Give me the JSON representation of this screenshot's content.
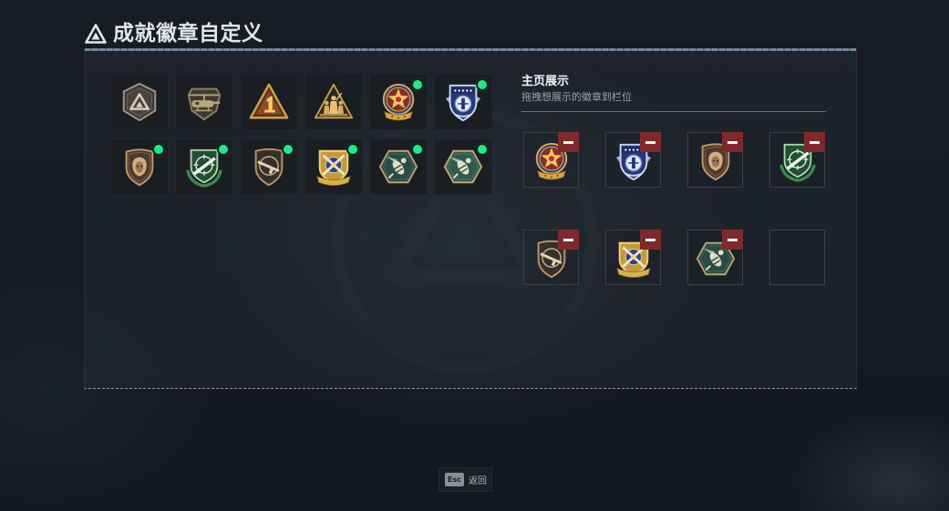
{
  "screen": {
    "title": "成就徽章自定义",
    "title_icon": "triangle-logo-icon"
  },
  "theme": {
    "background": "#151a20",
    "indicator": "#2fe08c",
    "remove": "#7e2a2d",
    "text_primary": "#ececec",
    "text_secondary": "#9ea3a8"
  },
  "badge_collection": {
    "badges": [
      {
        "icon": "triangle-hex-badge-icon",
        "indicator": false
      },
      {
        "icon": "helicopter-badge-icon",
        "indicator": false
      },
      {
        "icon": "triangle-one-badge-icon",
        "indicator": false
      },
      {
        "icon": "soldiers-triangle-badge-icon",
        "indicator": false
      },
      {
        "icon": "star-medal-badge-icon",
        "indicator": true
      },
      {
        "icon": "blue-shield-badge-icon",
        "indicator": true
      },
      {
        "icon": "lion-shield-badge-icon",
        "indicator": true
      },
      {
        "icon": "green-rifle-shield-badge-icon",
        "indicator": true
      },
      {
        "icon": "gun-shield-badge-icon",
        "indicator": true
      },
      {
        "icon": "crossed-weapons-badge-icon",
        "indicator": true
      },
      {
        "icon": "hex-wasp-badge-icon",
        "indicator": true
      },
      {
        "icon": "hex-eagle-badge-icon",
        "indicator": true
      }
    ]
  },
  "showcase": {
    "title": "主页展示",
    "subtitle": "拖拽想展示的徽章到栏位",
    "remove_icon": "minus-icon",
    "slots": [
      {
        "icon": "star-medal-badge-icon"
      },
      {
        "icon": "blue-shield-badge-icon"
      },
      {
        "icon": "lion-shield-badge-icon"
      },
      {
        "icon": "green-rifle-shield-badge-icon"
      },
      {
        "icon": "gun-shield-badge-icon"
      },
      {
        "icon": "crossed-weapons-badge-icon"
      },
      {
        "icon": "hex-wasp-badge-icon"
      },
      {
        "icon": null
      }
    ]
  },
  "footer": {
    "key_label": "Esc",
    "action_label": "返回"
  }
}
